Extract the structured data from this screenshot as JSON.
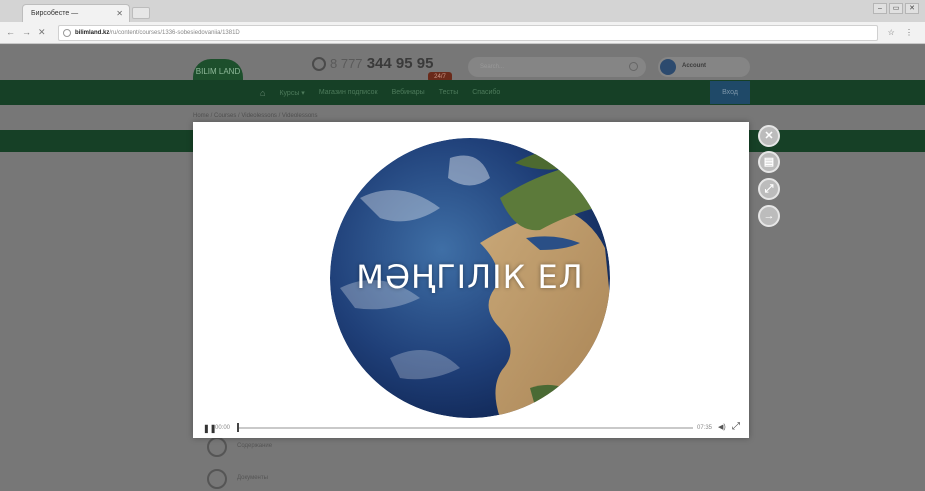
{
  "browser": {
    "tab_title": "Бирсобесте —  ",
    "tab_close": "✕",
    "url_domain": "bilimland.kz",
    "url_path": "/ru/content/courses/1336-sobesiedovaniia/1381D",
    "nav_back": "←",
    "nav_forward": "→",
    "nav_reload": "✕",
    "window_controls": [
      "–",
      "▭",
      "✕"
    ]
  },
  "site": {
    "logo_text": "BILIM LAND",
    "phone_prefix": "8 777",
    "phone_number": "344 95 95",
    "phone_badge": "24/7",
    "search_placeholder": "Search...",
    "account_name": "Account",
    "menu": [
      "Курсы ▾",
      "Магазин подписок",
      "Вебинары",
      "Тесты",
      "Спасибо"
    ],
    "login_label": "Вход",
    "breadcrumb": "Home / Courses / Videolessons / Videolessons",
    "side_items": [
      "Содержание",
      "Документы"
    ]
  },
  "player": {
    "slide_title": "МӘҢГІЛІК ЕЛ",
    "play_icon": "❚❚",
    "current_time": "00:00",
    "duration": "07:35",
    "volume_icon": "◀)",
    "fullscreen_icon": "⤢",
    "progress": 0.0
  },
  "lightbox_buttons": [
    {
      "icon": "close-icon",
      "glyph": "✕"
    },
    {
      "icon": "grid-icon",
      "glyph": "▤"
    },
    {
      "icon": "expand-icon",
      "glyph": "⤢"
    },
    {
      "icon": "next-icon",
      "glyph": "→"
    }
  ]
}
